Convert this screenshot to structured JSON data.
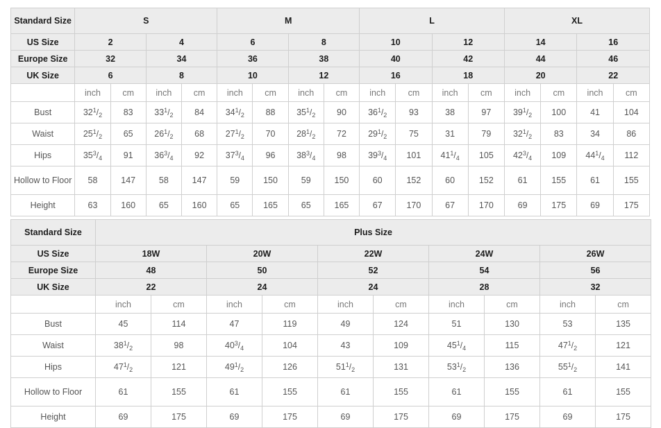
{
  "table1": {
    "label_column_header": "Standard Size",
    "group_headers": [
      "S",
      "M",
      "L",
      "XL"
    ],
    "row_labels": {
      "us": "US Size",
      "europe": "Europe Size",
      "uk": "UK Size"
    },
    "us_sizes": [
      "2",
      "4",
      "6",
      "8",
      "10",
      "12",
      "14",
      "16"
    ],
    "europe_sizes": [
      "32",
      "34",
      "36",
      "38",
      "40",
      "42",
      "44",
      "46"
    ],
    "uk_sizes": [
      "6",
      "8",
      "10",
      "12",
      "16",
      "18",
      "20",
      "22"
    ],
    "unit_labels": [
      "inch",
      "cm",
      "inch",
      "cm",
      "inch",
      "cm",
      "inch",
      "cm",
      "inch",
      "cm",
      "inch",
      "cm",
      "inch",
      "cm",
      "inch",
      "cm"
    ],
    "measurements": [
      {
        "label": "Bust",
        "inch": [
          "32 1/2",
          "33 1/2",
          "34 1/2",
          "35 1/2",
          "36 1/2",
          "38",
          "39 1/2",
          "41"
        ],
        "cm": [
          "83",
          "84",
          "88",
          "90",
          "93",
          "97",
          "100",
          "104"
        ]
      },
      {
        "label": "Waist",
        "inch": [
          "25 1/2",
          "26 1/2",
          "27 1/2",
          "28 1/2",
          "29 1/2",
          "31",
          "32 1/2",
          "34"
        ],
        "cm": [
          "65",
          "68",
          "70",
          "72",
          "75",
          "79",
          "83",
          "86"
        ]
      },
      {
        "label": "Hips",
        "inch": [
          "35 3/4",
          "36 3/4",
          "37 3/4",
          "38 3/4",
          "39 3/4",
          "41 1/4",
          "42 3/4",
          "44 1/4"
        ],
        "cm": [
          "91",
          "92",
          "96",
          "98",
          "101",
          "105",
          "109",
          "112"
        ]
      },
      {
        "label": "Hollow to Floor",
        "inch": [
          "58",
          "58",
          "59",
          "59",
          "60",
          "60",
          "61",
          "61"
        ],
        "cm": [
          "147",
          "147",
          "150",
          "150",
          "152",
          "152",
          "155",
          "155"
        ]
      },
      {
        "label": "Height",
        "inch": [
          "63",
          "65",
          "65",
          "65",
          "67",
          "67",
          "69",
          "69"
        ],
        "cm": [
          "160",
          "160",
          "165",
          "165",
          "170",
          "170",
          "175",
          "175"
        ]
      }
    ]
  },
  "table2": {
    "label_column_header": "Standard Size",
    "group_header": "Plus Size",
    "row_labels": {
      "us": "US Size",
      "europe": "Europe Size",
      "uk": "UK Size"
    },
    "us_sizes": [
      "18W",
      "20W",
      "22W",
      "24W",
      "26W"
    ],
    "europe_sizes": [
      "48",
      "50",
      "52",
      "54",
      "56"
    ],
    "uk_sizes": [
      "22",
      "24",
      "24",
      "28",
      "32"
    ],
    "unit_labels": [
      "inch",
      "cm",
      "inch",
      "cm",
      "inch",
      "cm",
      "inch",
      "cm",
      "inch",
      "cm"
    ],
    "measurements": [
      {
        "label": "Bust",
        "inch": [
          "45",
          "47",
          "49",
          "51",
          "53"
        ],
        "cm": [
          "114",
          "119",
          "124",
          "130",
          "135"
        ]
      },
      {
        "label": "Waist",
        "inch": [
          "38 1/2",
          "40 3/4",
          "43",
          "45 1/4",
          "47 1/2"
        ],
        "cm": [
          "98",
          "104",
          "109",
          "115",
          "121"
        ]
      },
      {
        "label": "Hips",
        "inch": [
          "47 1/2",
          "49 1/2",
          "51 1/2",
          "53 1/2",
          "55 1/2"
        ],
        "cm": [
          "121",
          "126",
          "131",
          "136",
          "141"
        ]
      },
      {
        "label": "Hollow to Floor",
        "inch": [
          "61",
          "61",
          "61",
          "61",
          "61"
        ],
        "cm": [
          "155",
          "155",
          "155",
          "155",
          "155"
        ]
      },
      {
        "label": "Height",
        "inch": [
          "69",
          "69",
          "69",
          "69",
          "69"
        ],
        "cm": [
          "175",
          "175",
          "175",
          "175",
          "175"
        ]
      }
    ]
  },
  "colors": {
    "header_bg": "#ececec",
    "cell_bg": "#ffffff",
    "border": "#cfcfcf",
    "header_text": "#1c1c1c",
    "cell_text": "#555555",
    "unit_text": "#777777"
  }
}
